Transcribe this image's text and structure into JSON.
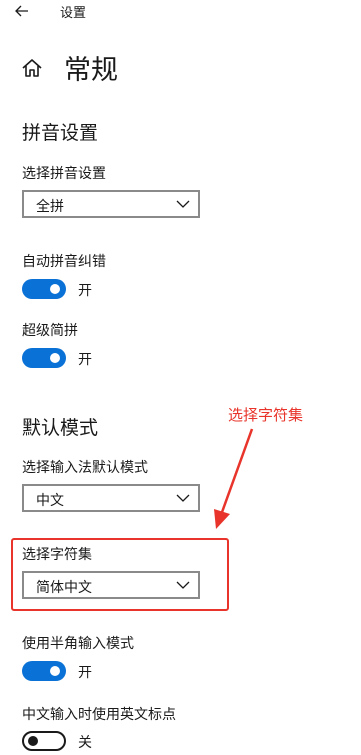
{
  "window": {
    "title": "设置"
  },
  "page": {
    "title": "常规"
  },
  "pinyin_section": {
    "title": "拼音设置",
    "select_label": "选择拼音设置",
    "select_value": "全拼",
    "fuzzy_label": "自动拼音纠错",
    "fuzzy_state": "开",
    "super_label": "超级简拼",
    "super_state": "开"
  },
  "default_mode_section": {
    "title": "默认模式",
    "select_label": "选择输入法默认模式",
    "select_value": "中文",
    "charset_label": "选择字符集",
    "charset_value": "简体中文",
    "halfwidth_label": "使用半角输入模式",
    "halfwidth_state": "开",
    "en_punct_label": "中文输入时使用英文标点",
    "en_punct_state": "关"
  },
  "annotation": {
    "label": "选择字符集",
    "color": "#e8342a"
  },
  "colors": {
    "accent": "#0a71d6",
    "text": "#1a1a1a",
    "border": "#8a8a8a"
  },
  "icons": {
    "back": "back-arrow-icon",
    "home": "home-icon",
    "chevron": "chevron-down-icon"
  }
}
